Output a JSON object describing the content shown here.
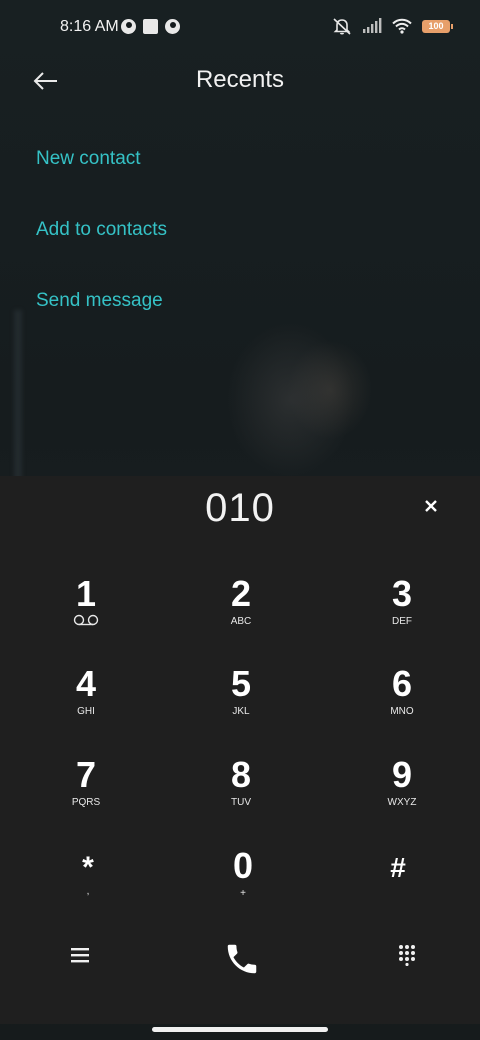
{
  "status_bar": {
    "time": "8:16 AM",
    "battery_level": "100",
    "icons": [
      "notification-icon",
      "square-notification-icon",
      "notification-icon",
      "mute-icon",
      "signal-icon",
      "wifi-icon",
      "battery-icon"
    ]
  },
  "header": {
    "title": "Recents",
    "back_icon": "back-arrow-icon"
  },
  "actions": [
    {
      "label": "New contact"
    },
    {
      "label": "Add to contacts"
    },
    {
      "label": "Send message"
    }
  ],
  "dialer": {
    "number": "010",
    "clear_icon": "close-icon",
    "keys": [
      {
        "digit": "1",
        "letters": "",
        "icon": "voicemail-icon"
      },
      {
        "digit": "2",
        "letters": "ABC"
      },
      {
        "digit": "3",
        "letters": "DEF"
      },
      {
        "digit": "4",
        "letters": "GHI"
      },
      {
        "digit": "5",
        "letters": "JKL"
      },
      {
        "digit": "6",
        "letters": "MNO"
      },
      {
        "digit": "7",
        "letters": "PQRS"
      },
      {
        "digit": "8",
        "letters": "TUV"
      },
      {
        "digit": "9",
        "letters": "WXYZ"
      },
      {
        "digit": "*",
        "letters": ","
      },
      {
        "digit": "0",
        "letters": "+"
      },
      {
        "digit": "#",
        "letters": ""
      }
    ],
    "bottom_bar": {
      "menu_icon": "menu-icon",
      "call_icon": "phone-call-icon",
      "keypad_icon": "keypad-icon"
    }
  },
  "colors": {
    "accent": "#35c2c6",
    "dialer_background": "#1f1f1f",
    "battery": "#e79f6a"
  }
}
